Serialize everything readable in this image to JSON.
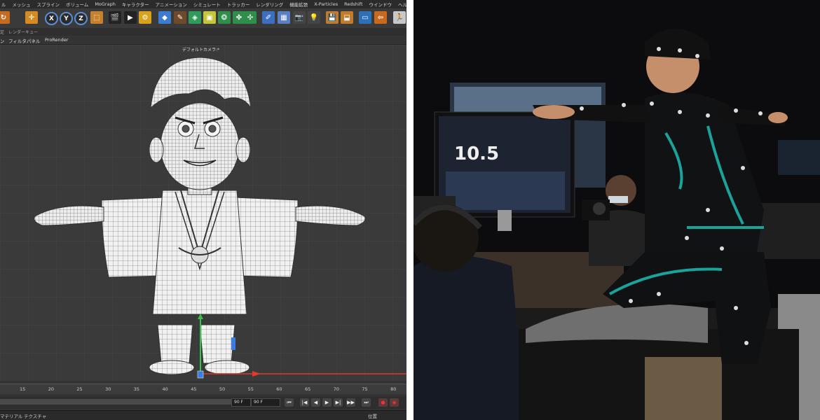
{
  "menu": [
    "ル",
    "メッシュ",
    "スプライン",
    "ボリューム",
    "MoGraph",
    "キャラクター",
    "アニメーション",
    "シミュレート",
    "トラッカー",
    "レンダリング",
    "機能拡張",
    "X-Particles",
    "Redshift",
    "ウインドウ",
    "ヘルプ"
  ],
  "axis_buttons": [
    "X",
    "Y",
    "Z"
  ],
  "subbar": {
    "left": "定",
    "tab": "レンダーキュー"
  },
  "viewport_menu": [
    "ン",
    "フィルタ",
    "パネル",
    "ProRender"
  ],
  "camera_label": "デフォルトカメラ:*",
  "ruler_ticks": [
    "15",
    "20",
    "25",
    "30",
    "35",
    "40",
    "45",
    "50",
    "55",
    "60",
    "65",
    "70",
    "75",
    "80"
  ],
  "playback": {
    "end_frame": "90 F",
    "end_frame_2": "90 F"
  },
  "bottom": {
    "materials": "マテリアル",
    "texture": "テクスチャ",
    "position": "位置"
  },
  "colors": {
    "axis_y": "#36c24a",
    "axis_x": "#e03a2a",
    "axis_z": "#3b7de0"
  },
  "photo": {
    "monitor_text": "10.5"
  }
}
